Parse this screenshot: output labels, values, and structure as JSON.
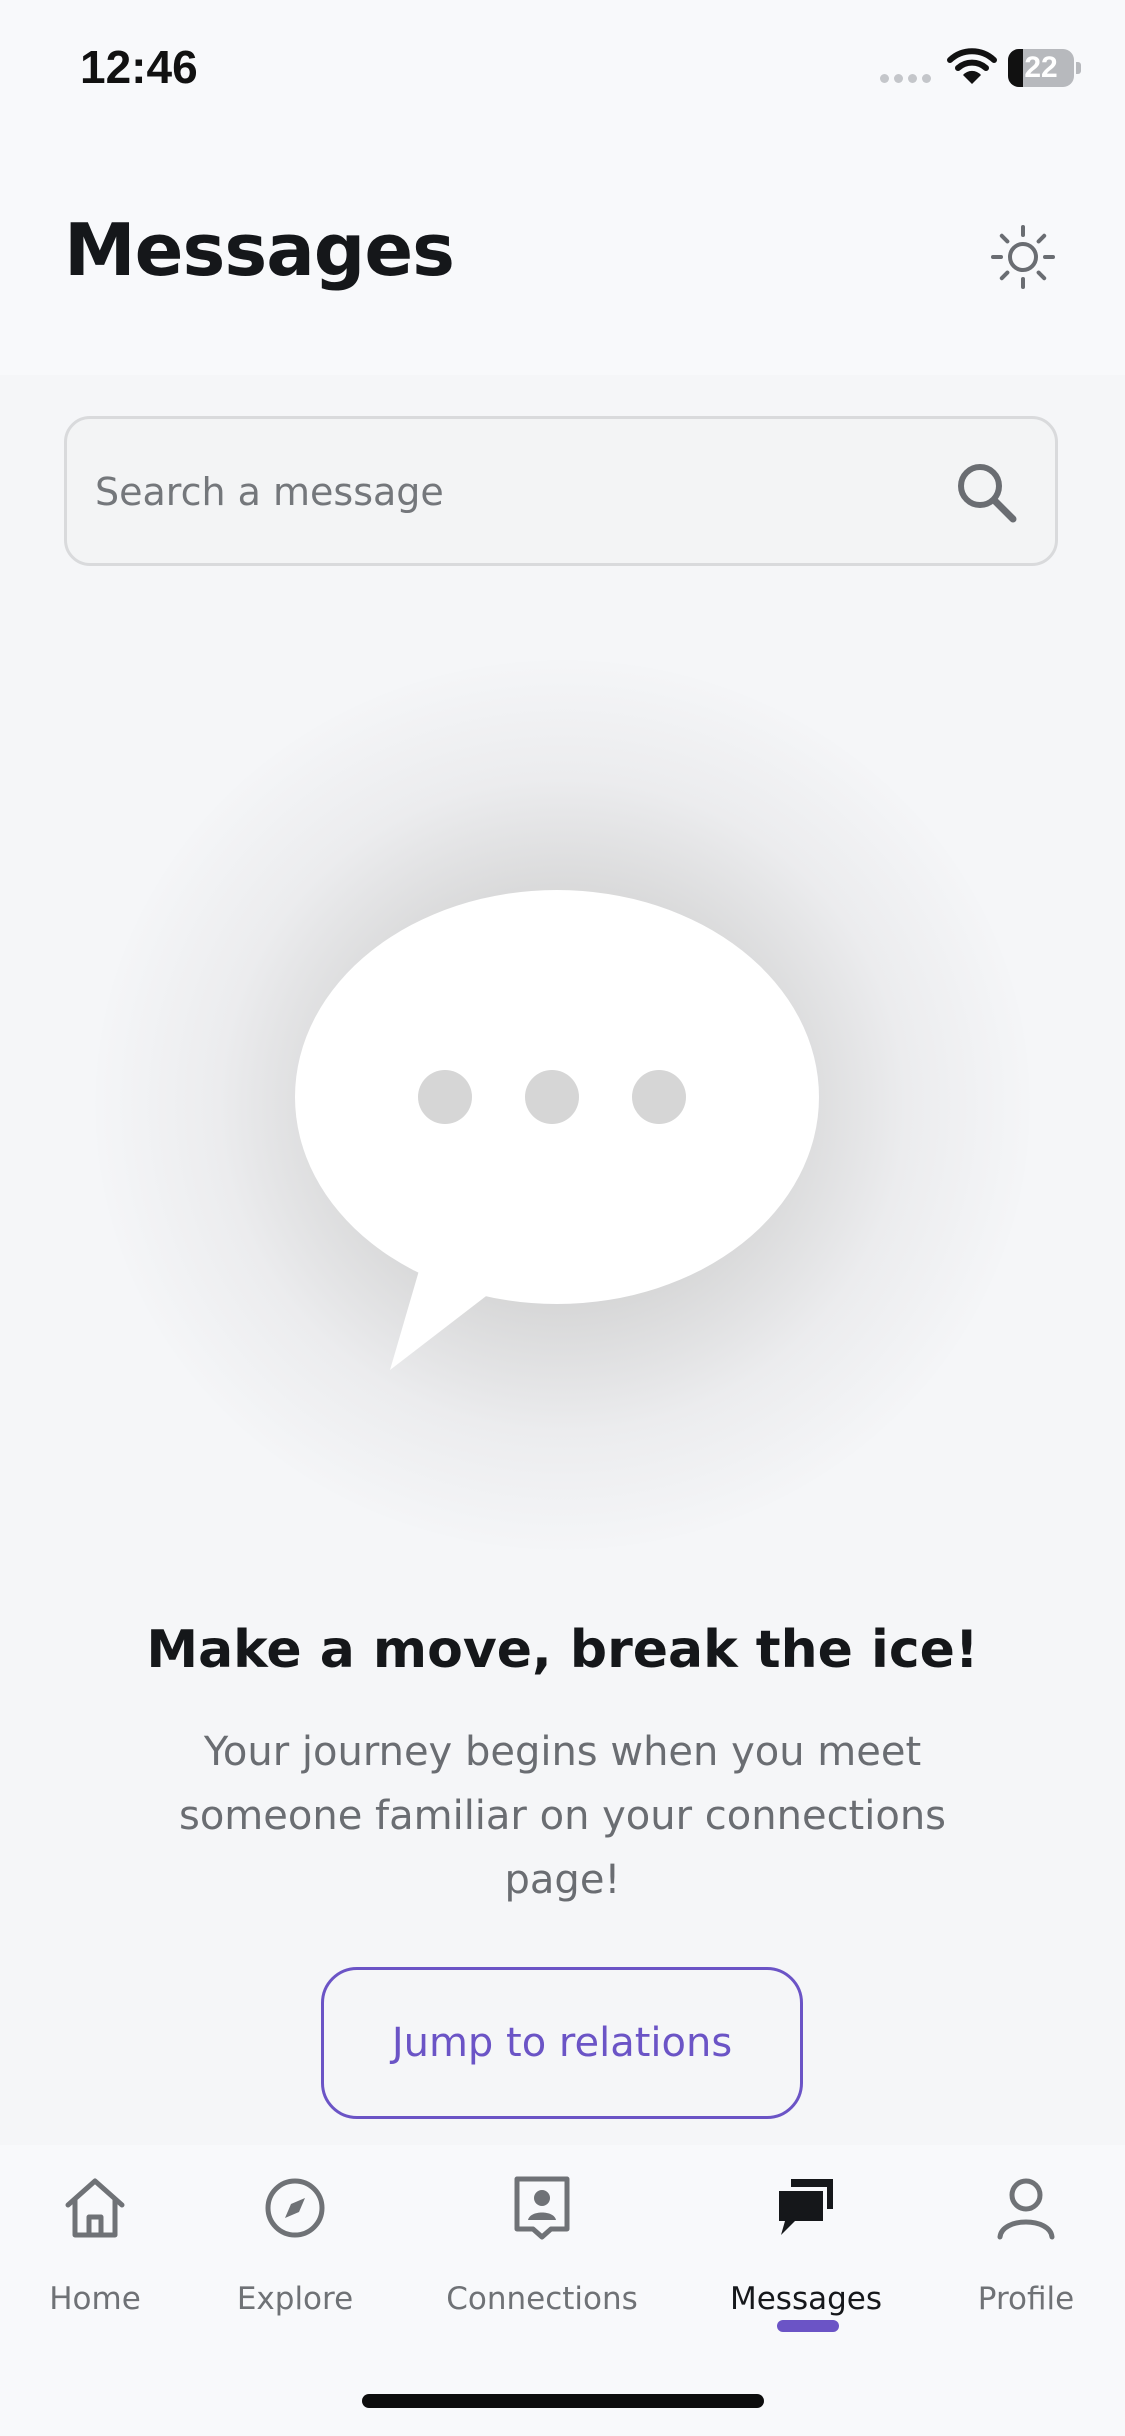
{
  "status_bar": {
    "time": "12:46",
    "battery_level": "22",
    "battery_fraction": 0.22
  },
  "header": {
    "title": "Messages",
    "theme_icon": "sun-icon"
  },
  "search": {
    "placeholder": "Search a message",
    "icon": "search-icon"
  },
  "empty_state": {
    "icon": "chat-bubble-icon",
    "title": "Make a move, break the ice!",
    "text": "Your journey begins when you meet someone familiar on your connections page!",
    "button_label": "Jump to relations"
  },
  "tab_bar": {
    "active_tab": "Messages",
    "accent_color": "#6b54c6",
    "tabs": [
      {
        "label": "Home",
        "icon": "home-icon"
      },
      {
        "label": "Explore",
        "icon": "compass-icon"
      },
      {
        "label": "Connections",
        "icon": "contact-card-icon"
      },
      {
        "label": "Messages",
        "icon": "chat-bubbles-icon"
      },
      {
        "label": "Profile",
        "icon": "person-icon"
      }
    ]
  }
}
